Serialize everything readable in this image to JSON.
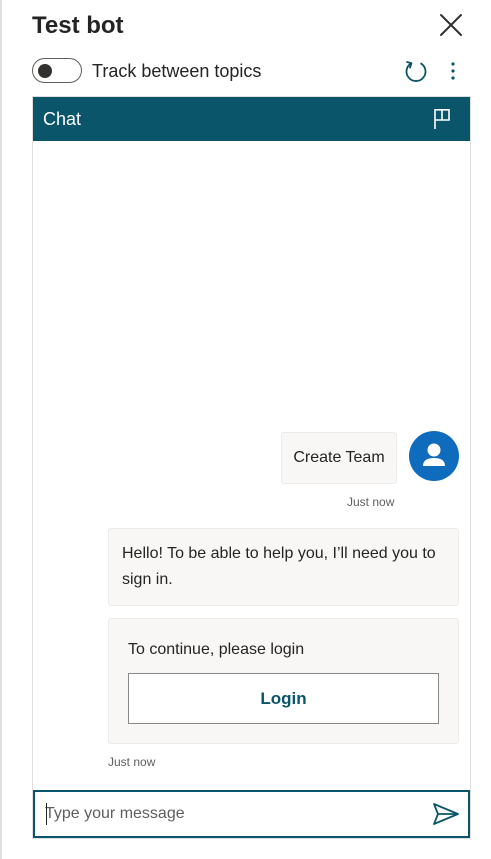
{
  "panel": {
    "title": "Test bot",
    "track_label": "Track between topics",
    "track_enabled": false
  },
  "chat": {
    "header_title": "Chat",
    "messages": [
      {
        "from": "user",
        "text": "Create Team",
        "timestamp": "Just now"
      },
      {
        "from": "bot",
        "text": "Hello! To be able to help you, I’ll need you to sign in."
      }
    ],
    "login_card": {
      "text": "To continue, please login",
      "button_label": "Login",
      "timestamp": "Just now"
    },
    "input": {
      "placeholder": "Type your message",
      "value": ""
    }
  },
  "icons": {
    "close": "close-icon",
    "refresh": "refresh-icon",
    "more": "more-vertical-icon",
    "flag": "flag-icon",
    "avatar": "user-avatar-icon",
    "send": "send-icon"
  },
  "colors": {
    "accent": "#0b556a",
    "avatar": "#0f6cbd",
    "bubble_bg": "#f8f7f6"
  }
}
